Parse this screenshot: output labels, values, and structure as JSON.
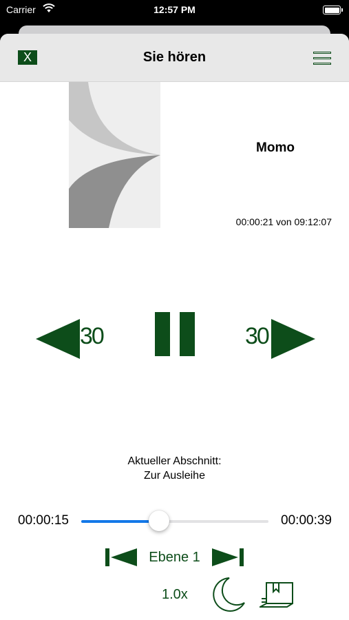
{
  "status_bar": {
    "carrier": "Carrier",
    "time": "12:57 PM"
  },
  "nav": {
    "close_label": "X",
    "title": "Sie hören"
  },
  "book": {
    "title": "Momo",
    "time_info": "00:00:21 von 09:12:07"
  },
  "controls": {
    "rewind_seconds": "30",
    "forward_seconds": "30"
  },
  "chapter": {
    "caption": "Aktueller Abschnitt:",
    "name": "Zur Ausleihe"
  },
  "progress": {
    "elapsed": "00:00:15",
    "remaining": "00:00:39",
    "fraction": 0.417
  },
  "level": {
    "label": "Ebene 1"
  },
  "speed": "1.0x",
  "colors": {
    "accent": "#0d4d1a",
    "slider": "#1378e8"
  }
}
